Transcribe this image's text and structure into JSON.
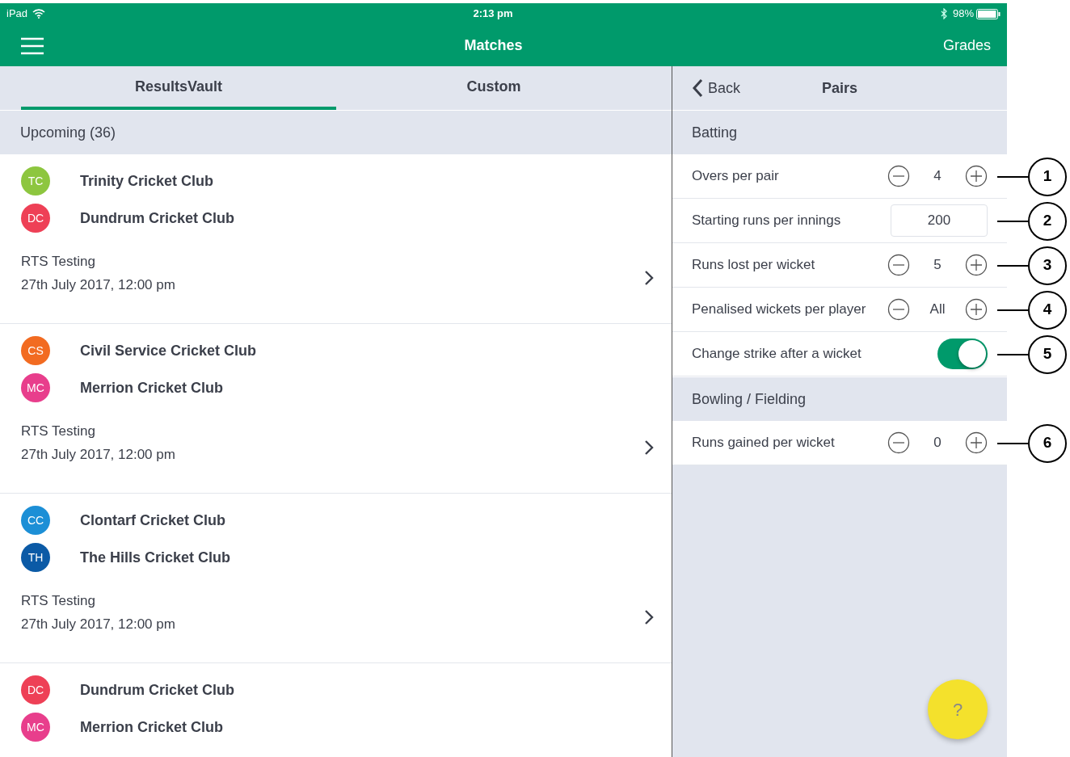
{
  "status_bar": {
    "carrier": "iPad",
    "time": "2:13 pm",
    "battery": "98%"
  },
  "header": {
    "title": "Matches",
    "action": "Grades"
  },
  "tabs": [
    {
      "label": "ResultsVault",
      "selected": true
    },
    {
      "label": "Custom",
      "selected": false
    }
  ],
  "list_header": "Upcoming (36)",
  "matches": [
    {
      "teams": [
        {
          "initials": "TC",
          "name": "Trinity Cricket Club",
          "color": "#8dc63f"
        },
        {
          "initials": "DC",
          "name": "Dundrum Cricket Club",
          "color": "#ee4056"
        }
      ],
      "competition": "RTS Testing",
      "datetime": "27th July 2017, 12:00 pm"
    },
    {
      "teams": [
        {
          "initials": "CS",
          "name": "Civil Service Cricket Club",
          "color": "#f26b21"
        },
        {
          "initials": "MC",
          "name": "Merrion Cricket Club",
          "color": "#e83e8c"
        }
      ],
      "competition": "RTS Testing",
      "datetime": "27th July 2017, 12:00 pm"
    },
    {
      "teams": [
        {
          "initials": "CC",
          "name": "Clontarf Cricket Club",
          "color": "#1c8fd6"
        },
        {
          "initials": "TH",
          "name": "The Hills Cricket Club",
          "color": "#0b5aa6"
        }
      ],
      "competition": "RTS Testing",
      "datetime": "27th July 2017, 12:00 pm"
    },
    {
      "teams": [
        {
          "initials": "DC",
          "name": "Dundrum Cricket Club",
          "color": "#ee4056"
        },
        {
          "initials": "MC",
          "name": "Merrion Cricket Club",
          "color": "#e83e8c"
        }
      ]
    }
  ],
  "panel": {
    "back": "Back",
    "title": "Pairs",
    "sections": [
      {
        "title": "Batting",
        "rows": [
          {
            "kind": "stepper",
            "label": "Overs per pair",
            "value": "4",
            "callout": "1"
          },
          {
            "kind": "field",
            "label": "Starting runs per innings",
            "value": "200",
            "callout": "2"
          },
          {
            "kind": "stepper",
            "label": "Runs lost per wicket",
            "value": "5",
            "callout": "3"
          },
          {
            "kind": "stepper",
            "label": "Penalised wickets per player",
            "value": "All",
            "callout": "4"
          },
          {
            "kind": "toggle",
            "label": "Change strike after a wicket",
            "on": true,
            "callout": "5"
          }
        ]
      },
      {
        "title": "Bowling / Fielding",
        "rows": [
          {
            "kind": "stepper",
            "label": "Runs gained per wicket",
            "value": "0",
            "callout": "6"
          }
        ]
      }
    ]
  },
  "help": "?"
}
